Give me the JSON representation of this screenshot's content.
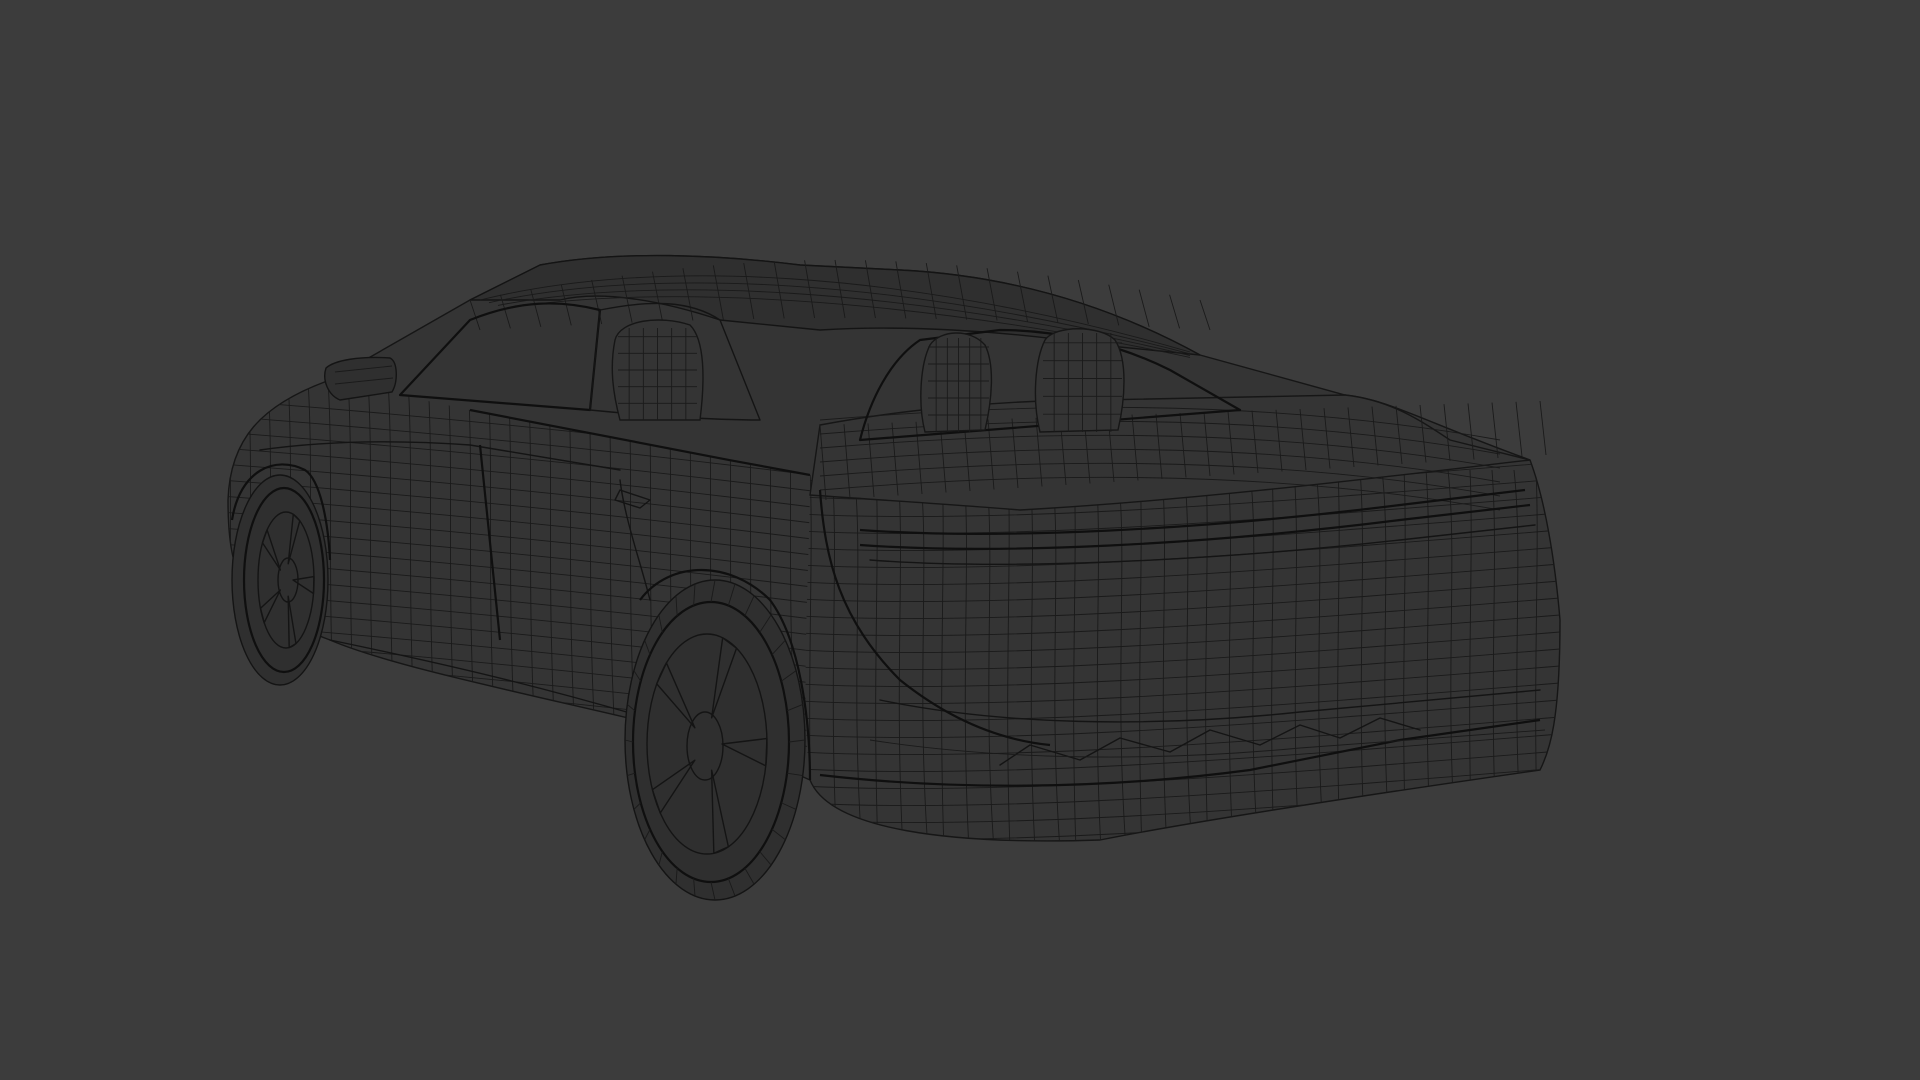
{
  "viewport": {
    "background_color": "#3c3c3c",
    "wire_color": "#141414",
    "shading": "wireframe",
    "subject": "car-model-rear-three-quarter"
  }
}
